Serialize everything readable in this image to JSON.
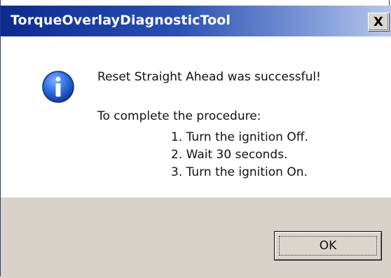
{
  "dialog": {
    "title": "TorqueOverlayDiagnosticTool",
    "close_label": "X",
    "message": "Reset Straight Ahead was successful!",
    "procedure_intro": "To complete the procedure:",
    "steps": [
      "1. Turn the ignition Off.",
      "2. Wait 30 seconds.",
      "3. Turn the ignition On."
    ],
    "ok_label": "OK",
    "icon": "info-icon"
  },
  "colors": {
    "titlebar_start": "#0b2a8f",
    "titlebar_end": "#b9c8ec",
    "footer_bg": "#d7d3cb",
    "icon_blue": "#1d5fd1"
  }
}
